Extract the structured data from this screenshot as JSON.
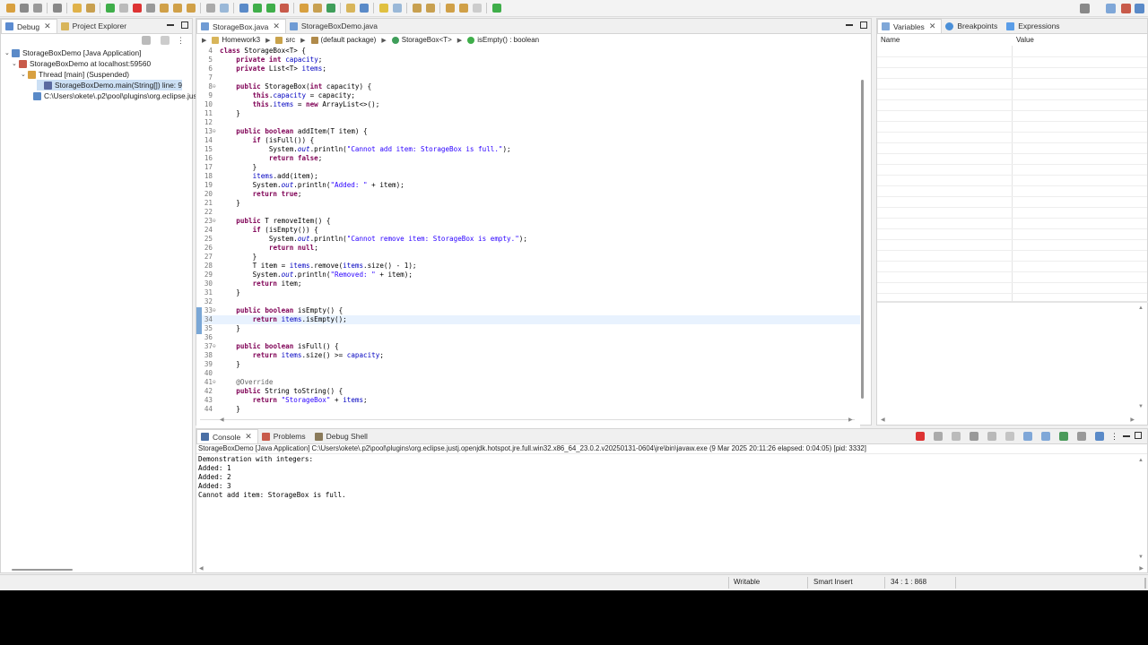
{
  "colors": {
    "accent": "#cce0f5",
    "keyword": "#7f0055",
    "field": "#0000c0",
    "string": "#2a00ff",
    "current_line": "#e8f2fe"
  },
  "left_panel": {
    "tabs": [
      {
        "label": "Debug",
        "icon": "debug-icon"
      },
      {
        "label": "Project Explorer",
        "icon": "project-explorer-icon"
      }
    ],
    "tree": [
      {
        "label": "StorageBoxDemo [Java Application]",
        "level": 0
      },
      {
        "label": "StorageBoxDemo at localhost:59560",
        "level": 1
      },
      {
        "label": "Thread [main] (Suspended)",
        "level": 2
      },
      {
        "label": "StorageBoxDemo.main(String[]) line: 9",
        "level": 3
      },
      {
        "label": "C:\\Users\\okete\\.p2\\pool\\plugins\\org.eclipse.justj.",
        "level": 1
      }
    ]
  },
  "editor": {
    "tabs": [
      {
        "label": "StorageBox.java",
        "active": true
      },
      {
        "label": "StorageBoxDemo.java",
        "active": false
      }
    ],
    "breadcrumb": [
      "Homework3",
      "src",
      "(default package)",
      "StorageBox<T>",
      "isEmpty() : boolean"
    ],
    "current_line": 34,
    "lines": [
      {
        "n": "4",
        "fold": "",
        "html": "<span class='kw'>class</span> StorageBox&lt;T&gt; {"
      },
      {
        "n": "5",
        "fold": "",
        "html": "    <span class='kw'>private</span> <span class='kw'>int</span> <span class='fld'>capacity</span>;"
      },
      {
        "n": "6",
        "fold": "",
        "html": "    <span class='kw'>private</span> List&lt;T&gt; <span class='fld'>items</span>;"
      },
      {
        "n": "7",
        "fold": "",
        "html": ""
      },
      {
        "n": "8",
        "fold": "⊖",
        "html": "    <span class='kw'>public</span> StorageBox(<span class='kw'>int</span> capacity) {"
      },
      {
        "n": "9",
        "fold": "",
        "html": "        <span class='kw'>this</span>.<span class='fld'>capacity</span> = capacity;"
      },
      {
        "n": "10",
        "fold": "",
        "html": "        <span class='kw'>this</span>.<span class='fld'>items</span> = <span class='kw'>new</span> ArrayList&lt;&gt;();"
      },
      {
        "n": "11",
        "fold": "",
        "html": "    }"
      },
      {
        "n": "12",
        "fold": "",
        "html": ""
      },
      {
        "n": "13",
        "fold": "⊖",
        "html": "    <span class='kw'>public</span> <span class='kw'>boolean</span> addItem(T item) {"
      },
      {
        "n": "14",
        "fold": "",
        "html": "        <span class='kw'>if</span> (isFull()) {"
      },
      {
        "n": "15",
        "fold": "",
        "html": "            System.<span class='stat'>out</span>.println(<span class='str'>\"Cannot add item: StorageBox is full.\"</span>);"
      },
      {
        "n": "16",
        "fold": "",
        "html": "            <span class='kw'>return</span> <span class='kw'>false</span>;"
      },
      {
        "n": "17",
        "fold": "",
        "html": "        }"
      },
      {
        "n": "18",
        "fold": "",
        "html": "        <span class='fld'>items</span>.add(item);"
      },
      {
        "n": "19",
        "fold": "",
        "html": "        System.<span class='stat'>out</span>.println(<span class='str'>\"Added: \"</span> + item);"
      },
      {
        "n": "20",
        "fold": "",
        "html": "        <span class='kw'>return</span> <span class='kw'>true</span>;"
      },
      {
        "n": "21",
        "fold": "",
        "html": "    }"
      },
      {
        "n": "22",
        "fold": "",
        "html": ""
      },
      {
        "n": "23",
        "fold": "⊖",
        "html": "    <span class='kw'>public</span> T removeItem() {"
      },
      {
        "n": "24",
        "fold": "",
        "html": "        <span class='kw'>if</span> (isEmpty()) {"
      },
      {
        "n": "25",
        "fold": "",
        "html": "            System.<span class='stat'>out</span>.println(<span class='str'>\"Cannot remove item: StorageBox is empty.\"</span>);"
      },
      {
        "n": "26",
        "fold": "",
        "html": "            <span class='kw'>return</span> <span class='kw'>null</span>;"
      },
      {
        "n": "27",
        "fold": "",
        "html": "        }"
      },
      {
        "n": "28",
        "fold": "",
        "html": "        T item = <span class='fld'>items</span>.remove(<span class='fld'>items</span>.size() - 1);"
      },
      {
        "n": "29",
        "fold": "",
        "html": "        System.<span class='stat'>out</span>.println(<span class='str'>\"Removed: \"</span> + item);"
      },
      {
        "n": "30",
        "fold": "",
        "html": "        <span class='kw'>return</span> item;"
      },
      {
        "n": "31",
        "fold": "",
        "html": "    }"
      },
      {
        "n": "32",
        "fold": "",
        "html": ""
      },
      {
        "n": "33",
        "fold": "⊖",
        "html": "    <span class='kw'>public</span> <span class='kw'>boolean</span> isEmpty() {"
      },
      {
        "n": "34",
        "fold": "",
        "html": "        <span class='kw'>return</span> <span class='fld'>items</span>.isEmpty();"
      },
      {
        "n": "35",
        "fold": "",
        "html": "    }"
      },
      {
        "n": "36",
        "fold": "",
        "html": ""
      },
      {
        "n": "37",
        "fold": "⊖",
        "html": "    <span class='kw'>public</span> <span class='kw'>boolean</span> isFull() {"
      },
      {
        "n": "38",
        "fold": "",
        "html": "        <span class='kw'>return</span> <span class='fld'>items</span>.size() &gt;= <span class='fld'>capacity</span>;"
      },
      {
        "n": "39",
        "fold": "",
        "html": "    }"
      },
      {
        "n": "40",
        "fold": "",
        "html": ""
      },
      {
        "n": "41",
        "fold": "⊖",
        "html": "    <span class='ann'>@Override</span>"
      },
      {
        "n": "42",
        "fold": "",
        "html": "    <span class='kw'>public</span> String toString() {"
      },
      {
        "n": "43",
        "fold": "",
        "html": "        <span class='kw'>return</span> <span class='str'>\"StorageBox\"</span> + <span class='fld'>items</span>;"
      },
      {
        "n": "44",
        "fold": "",
        "html": "    }"
      }
    ]
  },
  "variables_panel": {
    "tabs": [
      {
        "label": "Variables",
        "active": true
      },
      {
        "label": "Breakpoints"
      },
      {
        "label": "Expressions"
      }
    ],
    "columns": [
      "Name",
      "Value"
    ]
  },
  "console_panel": {
    "tabs": [
      {
        "label": "Console",
        "active": true
      },
      {
        "label": "Problems"
      },
      {
        "label": "Debug Shell"
      }
    ],
    "header": "StorageBoxDemo [Java Application] C:\\Users\\okete\\.p2\\pool\\plugins\\org.eclipse.justj.openjdk.hotspot.jre.full.win32.x86_64_23.0.2.v20250131-0604\\jre\\bin\\javaw.exe  (9 Mar 2025 20:11:26 elapsed: 0:04:05) [pid: 3332]",
    "output": [
      "Demonstration with integers:",
      "Added: 1",
      "Added: 2",
      "Added: 3",
      "Cannot add item: StorageBox is full."
    ]
  },
  "status_bar": {
    "writable": "Writable",
    "insert_mode": "Smart Insert",
    "position": "34 : 1 : 868"
  }
}
